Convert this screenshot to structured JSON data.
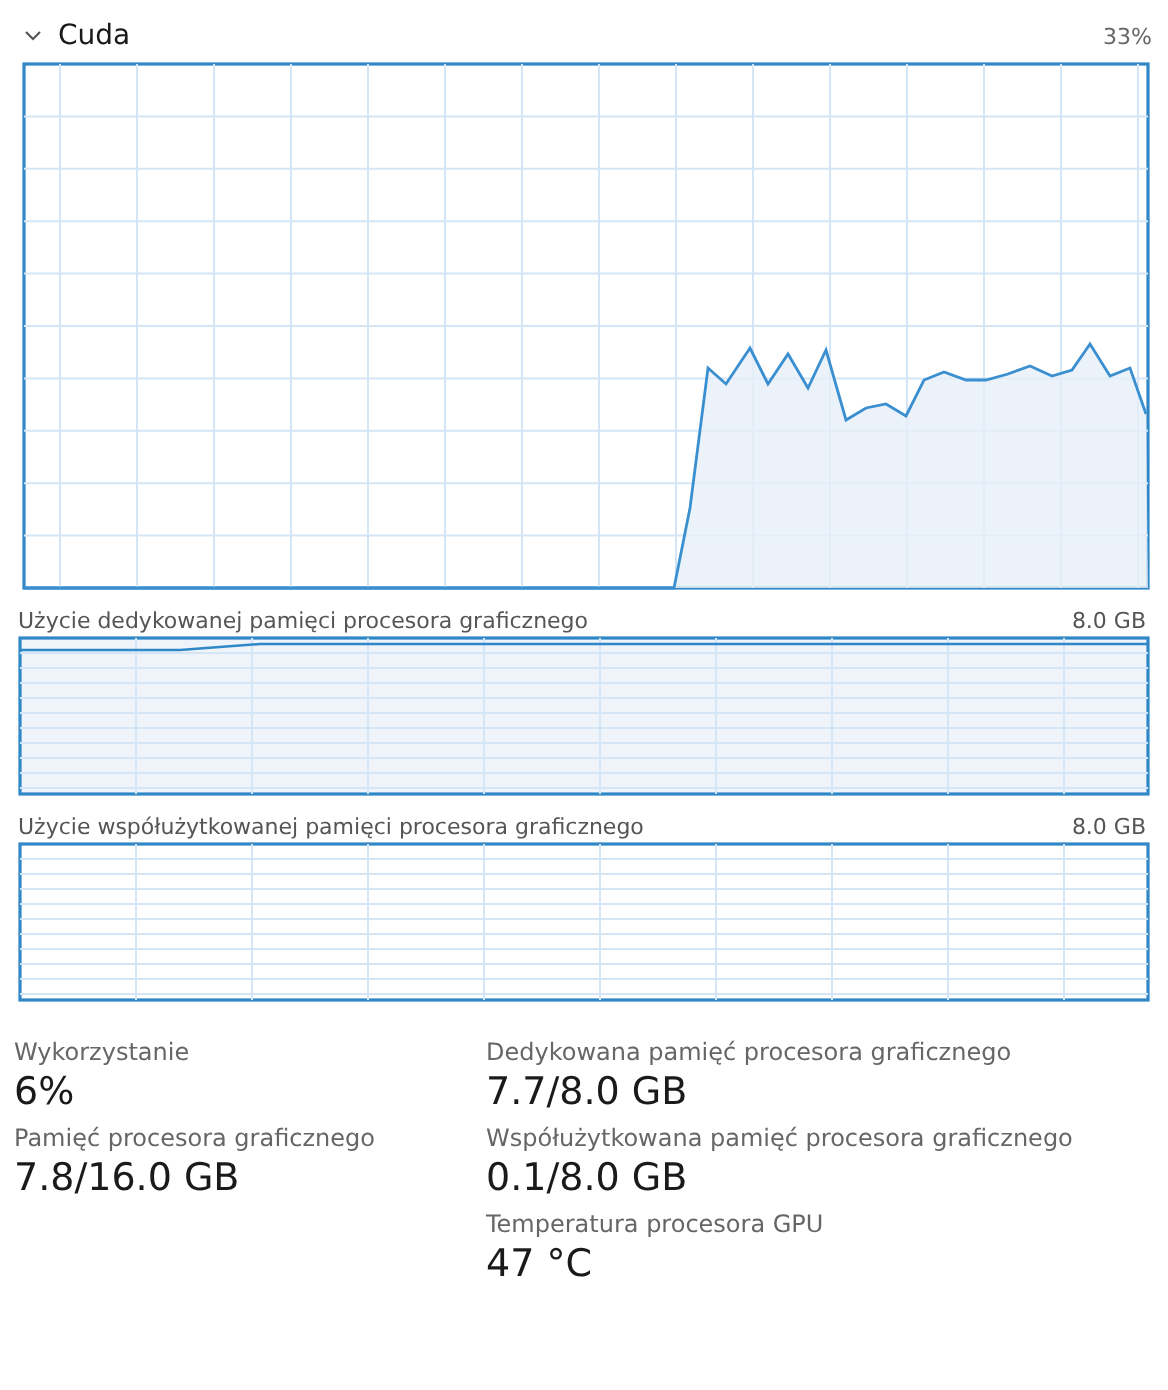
{
  "header": {
    "title": "Cuda",
    "value": "33%",
    "expanded": true
  },
  "memory_graphs": [
    {
      "label": "Użycie dedykowanej pamięci procesora graficznego",
      "max": "8.0 GB",
      "kind": "filled"
    },
    {
      "label": "Użycie współużytkowanej pamięci procesora graficznego",
      "max": "8.0 GB",
      "kind": "empty"
    }
  ],
  "stats": {
    "left": [
      {
        "label": "Wykorzystanie",
        "value": "6%"
      },
      {
        "label": "Pamięć procesora graficznego",
        "value": "7.8/16.0 GB"
      }
    ],
    "right": [
      {
        "label": "Dedykowana pamięć procesora graficznego",
        "value": "7.7/8.0 GB"
      },
      {
        "label": "Współużytkowana pamięć procesora graficznego",
        "value": "0.1/8.0 GB"
      },
      {
        "label": "Temperatura procesora GPU",
        "value": "47 °C"
      }
    ]
  }
}
